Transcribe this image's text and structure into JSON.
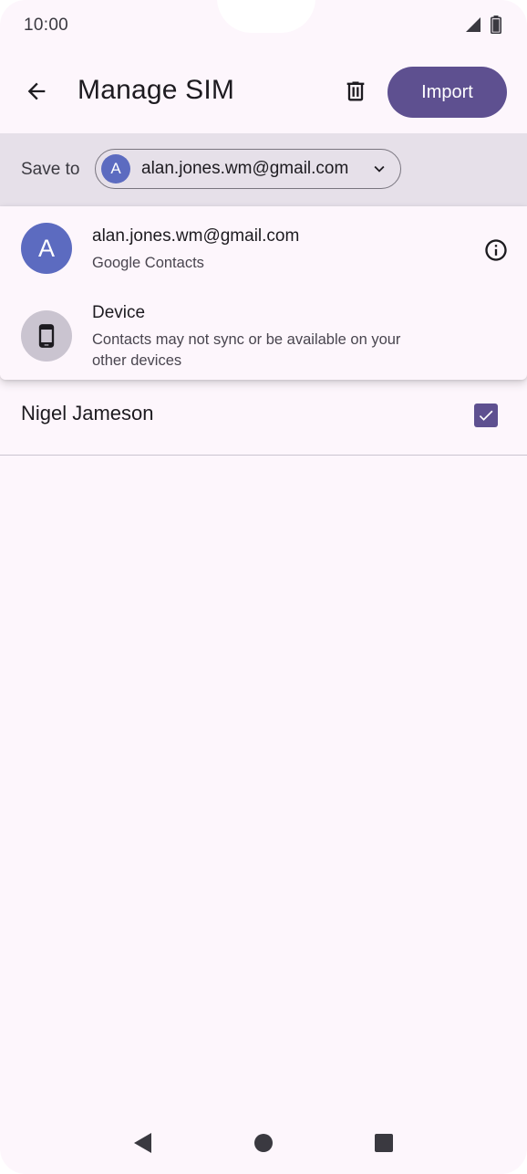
{
  "status_bar": {
    "time": "10:00",
    "icons": [
      "signal-icon",
      "battery-icon"
    ]
  },
  "app_bar": {
    "title": "Manage SIM",
    "back_icon": "arrow-back-icon",
    "delete_icon": "trash-icon",
    "import_label": "Import"
  },
  "save_to": {
    "label": "Save to",
    "selected_account": {
      "avatar_letter": "A",
      "email": "alan.jones.wm@gmail.com"
    }
  },
  "dropdown": {
    "items": [
      {
        "avatar_letter": "A",
        "title": "alan.jones.wm@gmail.com",
        "subtitle": "Google Contacts"
      },
      {
        "title": "Device",
        "subtitle": "Contacts may not sync or be available on your other devices"
      }
    ]
  },
  "contacts": [
    {
      "name": "Nigel Jameson",
      "checked": true
    }
  ],
  "colors": {
    "background": "#fdf6fc",
    "primary": "#5e5090",
    "avatar": "#5c6bc0",
    "save_bar": "#e6e0e9"
  }
}
